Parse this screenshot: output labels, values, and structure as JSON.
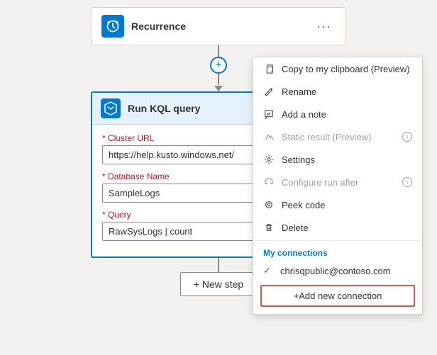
{
  "recurrence": {
    "title": "Recurrence",
    "more_label": "···"
  },
  "connector": {
    "plus_symbol": "+",
    "arrow": "▼"
  },
  "kql_card": {
    "title": "Run KQL query",
    "fields": [
      {
        "label": "* Cluster URL",
        "value": "https://help.kusto.windows.net/",
        "id": "cluster-url"
      },
      {
        "label": "* Database Name",
        "value": "SampleLogs",
        "id": "database-name"
      },
      {
        "label": "* Query",
        "value": "RawSysLogs | count",
        "id": "query"
      }
    ]
  },
  "new_step": {
    "label": "+ New step"
  },
  "context_menu": {
    "items": [
      {
        "id": "copy",
        "icon": "📋",
        "label": "Copy to my clipboard (Preview)",
        "disabled": false
      },
      {
        "id": "rename",
        "icon": "✏️",
        "label": "Rename",
        "disabled": false
      },
      {
        "id": "add-note",
        "icon": "💬",
        "label": "Add a note",
        "disabled": false
      },
      {
        "id": "static-result",
        "icon": "🧪",
        "label": "Static result (Preview)",
        "disabled": true,
        "info": true
      },
      {
        "id": "settings",
        "icon": "⚙️",
        "label": "Settings",
        "disabled": false
      },
      {
        "id": "configure-run",
        "icon": "🔗",
        "label": "Configure run after",
        "disabled": true,
        "info": true
      },
      {
        "id": "peek-code",
        "icon": "👁️",
        "label": "Peek code",
        "disabled": false
      },
      {
        "id": "delete",
        "icon": "🗑️",
        "label": "Delete",
        "disabled": false
      }
    ],
    "my_connections_label": "My connections",
    "connection_email": "chrisqpublic@contoso.com",
    "add_connection_label": "+Add new connection"
  }
}
